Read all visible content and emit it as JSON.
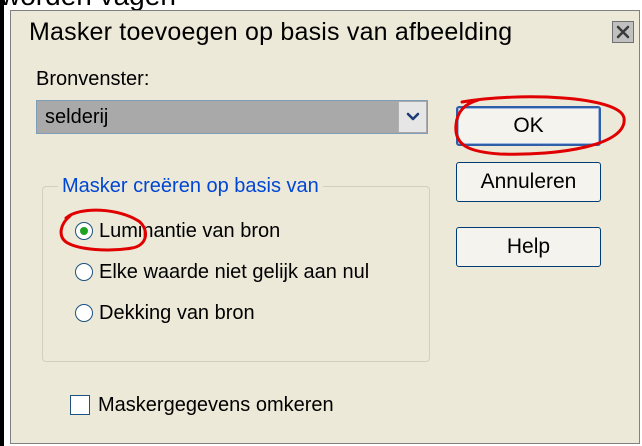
{
  "background_text": "worden vagen",
  "dialog": {
    "title": "Masker toevoegen op basis van afbeelding",
    "close_icon": "close-x-icon",
    "source_label": "Bronvenster:",
    "source_value": "selderij",
    "dropdown_icon": "chevron-down-icon",
    "buttons": {
      "ok": "OK",
      "cancel": "Annuleren",
      "help": "Help"
    },
    "group": {
      "title": "Masker creëren op basis van",
      "options": [
        {
          "label": "Luminantie van bron",
          "selected": true
        },
        {
          "label": "Elke waarde niet gelijk aan nul",
          "selected": false
        },
        {
          "label": "Dekking van bron",
          "selected": false
        }
      ]
    },
    "invert_label": "Maskergegevens omkeren",
    "invert_checked": false
  },
  "colors": {
    "dialog_bg": "#ece9d8",
    "annotation_red": "#e00000",
    "group_title": "#0046d5",
    "radio_selected": "#21a121"
  }
}
